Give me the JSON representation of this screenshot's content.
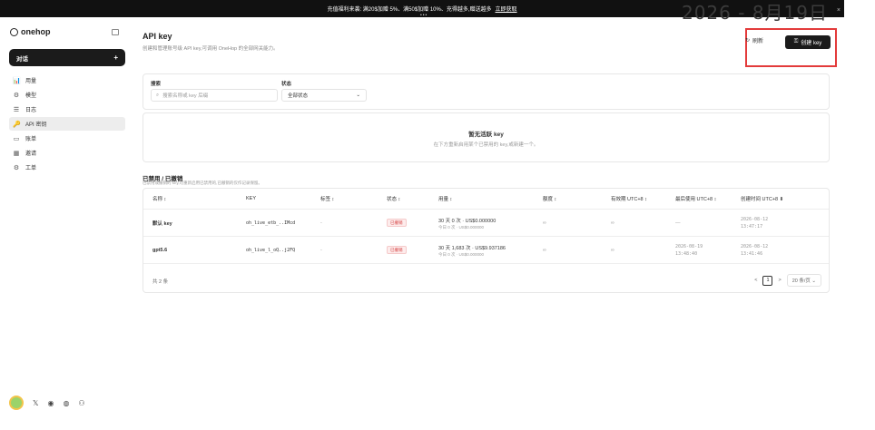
{
  "banner": {
    "text": "充值福利来袭: 满20$加赠 5%、满50$加赠 10%、充得越多,赠送越多",
    "link": "立即获取",
    "watermark": "2026 - 8月19日",
    "close": "×",
    "dots": "•••"
  },
  "sidebar": {
    "logo": "onehop",
    "chat_button": "对话",
    "chat_plus": "+",
    "items": [
      {
        "icon": "📊",
        "label": "用量"
      },
      {
        "icon": "⚙",
        "label": "模型"
      },
      {
        "icon": "☰",
        "label": "日志"
      },
      {
        "icon": "🔑",
        "label": "API 密钥"
      },
      {
        "icon": "▭",
        "label": "账单"
      },
      {
        "icon": "▦",
        "label": "邀请"
      },
      {
        "icon": "⚙",
        "label": "工单"
      }
    ],
    "footer_icons": [
      "𝕏",
      "◉",
      "◍",
      "⚇"
    ]
  },
  "header": {
    "title": "API key",
    "subtitle": "创建和管理账号级 API key,可调用 OneHop 的全部网关能力。",
    "refresh_label": "刷新",
    "create_label": "创建 key"
  },
  "filters": {
    "search_label": "搜索",
    "search_placeholder": "搜索名称或 key 后缀",
    "status_label": "状态",
    "status_value": "全部状态"
  },
  "empty_state": {
    "title": "暂无活跃 key",
    "subtitle": "在下方重新启用某个已禁用的 key,或新建一个。"
  },
  "disabled_section": {
    "title": "已禁用 / 已撤销",
    "subtitle": "已禁用或撤销的 key,可重新启用已禁用的,已撤销的仅作记录保留。",
    "columns": [
      "名称 ↕",
      "KEY",
      "标签 ↕",
      "状态 ↕",
      "用量 ↕",
      "额度 ↕",
      "有效期 UTC+8 ↕",
      "最后使用 UTC+8 ↕",
      "创建时间 UTC+8 ⬇"
    ],
    "rows": [
      {
        "name": "默认 key",
        "key": "oh_live_etb_..IMcd",
        "tag": "-",
        "status": "已撤销",
        "usage_main": "30 天 0 次 · US$0.000000",
        "usage_sub": "今日 0 次 · US$0.000000",
        "quota": "∞",
        "expiry": "∞",
        "last_used": "—",
        "created": "2026-08-12",
        "created_time": "13:47:17"
      },
      {
        "name": "gpt5.6",
        "key": "oh_live_l_oQ..j2FQ",
        "tag": "-",
        "status": "已撤销",
        "usage_main": "30 天 1,683 次 · US$9.937186",
        "usage_sub": "今日 0 次 · US$0.000000",
        "quota": "∞",
        "expiry": "∞",
        "last_used": "2026-08-19",
        "last_used_time": "13:48:40",
        "created": "2026-08-12",
        "created_time": "13:41:46"
      }
    ],
    "total": "共 2 条",
    "prev": "<",
    "page": "1",
    "next": ">",
    "per_page": "20 条/页 ⌄"
  },
  "colors": {
    "accent": "#1b1b1b",
    "highlight": "#e33b3b",
    "revoked": "#d64545"
  }
}
